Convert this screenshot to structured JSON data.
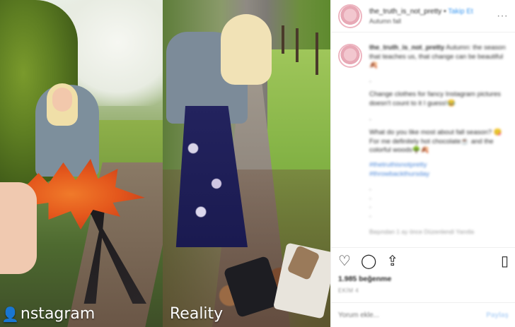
{
  "media": {
    "left_caption": "nstagram",
    "left_caption_icon": "person-icon",
    "right_caption": "Reality"
  },
  "post": {
    "username": "the_truth_is_not_pretty",
    "separator": "•",
    "follow_label": "Takip Et",
    "location": "Autumn fall",
    "more_glyph": "···"
  },
  "comment": {
    "username": "the_truth_is_not_pretty",
    "lines": [
      "Autumn: the season that teaches us, that change can be beautiful🍂",
      ".",
      "Change clothes for fancy Instagram pictures doesn't count to it I guess!😂",
      ".",
      "What do you like most about fall season? 😋 For me definitely hot chocolate☕ and the colorful woods🌳🍂"
    ],
    "tags": "#thetruthisnotpretty\n#throwbackthursday",
    "trailing_dots": [
      ".",
      ".",
      ".",
      "."
    ],
    "time": "Başından 1 ay önce  Düzenlendi  Yanıtla"
  },
  "actions": {
    "like_icon": "heart-icon",
    "comment_icon": "comment-icon",
    "share_icon": "share-icon",
    "save_icon": "bookmark-icon",
    "likes": "1.985 beğenme",
    "date": "EKİM 4"
  },
  "add_comment": {
    "placeholder": "Yorum ekle...",
    "post_label": "Paylaş"
  }
}
